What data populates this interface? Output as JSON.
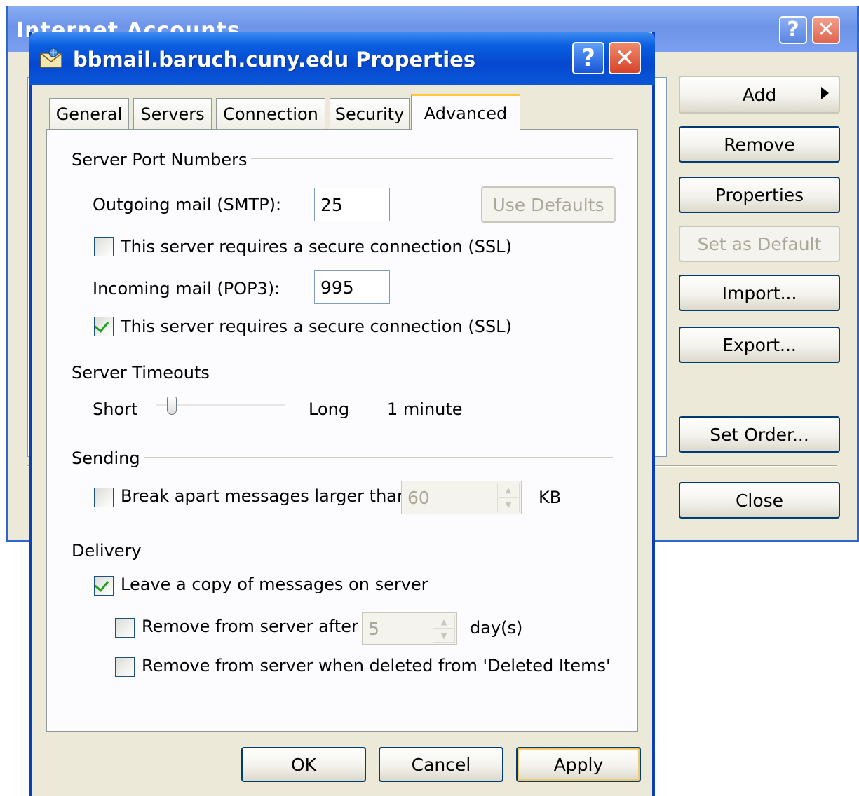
{
  "background_window": {
    "title": "Internet Accounts",
    "help_glyph": "?",
    "close_glyph": "✕",
    "buttons": {
      "add": "Add",
      "remove": "Remove",
      "properties": "Properties",
      "set_as_default": "Set as Default",
      "import": "Import...",
      "export": "Export...",
      "set_order": "Set Order...",
      "close": "Close"
    }
  },
  "dialog": {
    "title": "bbmail.baruch.cuny.edu Properties",
    "help_glyph": "?",
    "close_glyph": "✕",
    "tabs": [
      {
        "label": "General"
      },
      {
        "label": "Servers"
      },
      {
        "label": "Connection"
      },
      {
        "label": "Security"
      },
      {
        "label": "Advanced",
        "active": true
      }
    ],
    "server_ports": {
      "heading": "Server Port Numbers",
      "outgoing_label": "Outgoing mail (SMTP):",
      "outgoing_value": "25",
      "use_defaults": "Use Defaults",
      "smtp_ssl_label": "This server requires a secure connection (SSL)",
      "smtp_ssl_checked": false,
      "incoming_label": "Incoming mail (POP3):",
      "incoming_value": "995",
      "pop3_ssl_label": "This server requires a secure connection (SSL)",
      "pop3_ssl_checked": true
    },
    "timeouts": {
      "heading": "Server Timeouts",
      "short_label": "Short",
      "long_label": "Long",
      "value_text": "1 minute",
      "slider_level": 0.1
    },
    "sending": {
      "heading": "Sending",
      "break_apart_label": "Break apart messages larger than",
      "break_apart_checked": false,
      "break_apart_value": "60",
      "unit": "KB"
    },
    "delivery": {
      "heading": "Delivery",
      "leave_copy_label": "Leave a copy of messages on server",
      "leave_copy_checked": true,
      "remove_after_label": "Remove from server after",
      "remove_after_checked": false,
      "remove_after_value": "5",
      "remove_after_unit": "day(s)",
      "remove_deleted_label": "Remove from server when deleted from 'Deleted Items'",
      "remove_deleted_checked": false
    },
    "buttons": {
      "ok": "OK",
      "cancel": "Cancel",
      "apply": "Apply"
    }
  },
  "colors": {
    "title_bar_blue": "#0548cf",
    "dialog_face": "#ece9d8",
    "check_green": "#21a121",
    "tab_highlight": "#ffc83c"
  }
}
